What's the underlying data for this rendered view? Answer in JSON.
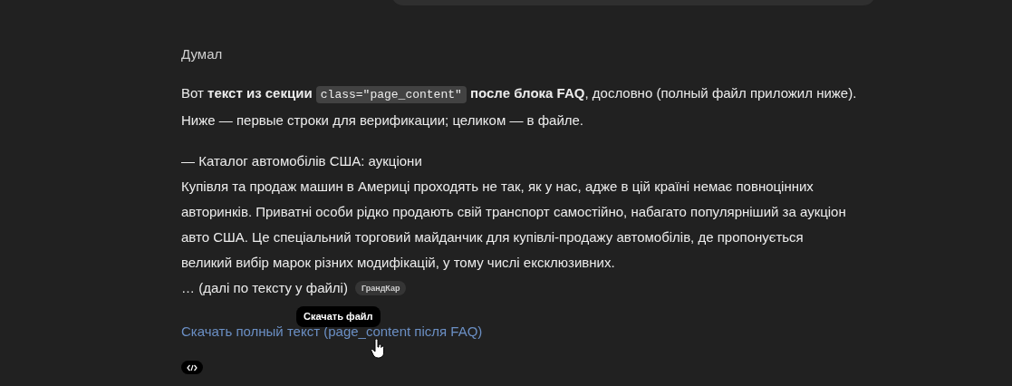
{
  "status": "Думал",
  "intro": {
    "before": "Вот ",
    "bold_1": "текст из секции",
    "code": "class=\"page_content\"",
    "bold_2": "после блока FAQ",
    "after": ", дословно (полный файл приложил ниже).",
    "line_2": "Ниже — первые строки для верификации; целиком — в файле."
  },
  "excerpt": {
    "heading": "— Каталог автомобілів США: аукціони",
    "paragraph": "Купівля та продаж машин в Америці проходять не так, як у нас, адже в цій країні немає повноцінних авторинків. Приватні особи рідко продають свій транспорт самостійно, набагато популярніший за аукціон авто США. Це спеціальний торговий майданчик для купівлі-продажу автомобілів, де пропонується великий вибір марок різних модифікацій, у тому числі ексклюзивних.",
    "continuation": "… (далі по тексту у файлі)",
    "source_badge": "ГрандКар"
  },
  "tooltip": "Скачать файл",
  "download_link": "Скачать полный текст (page_content після FAQ)"
}
